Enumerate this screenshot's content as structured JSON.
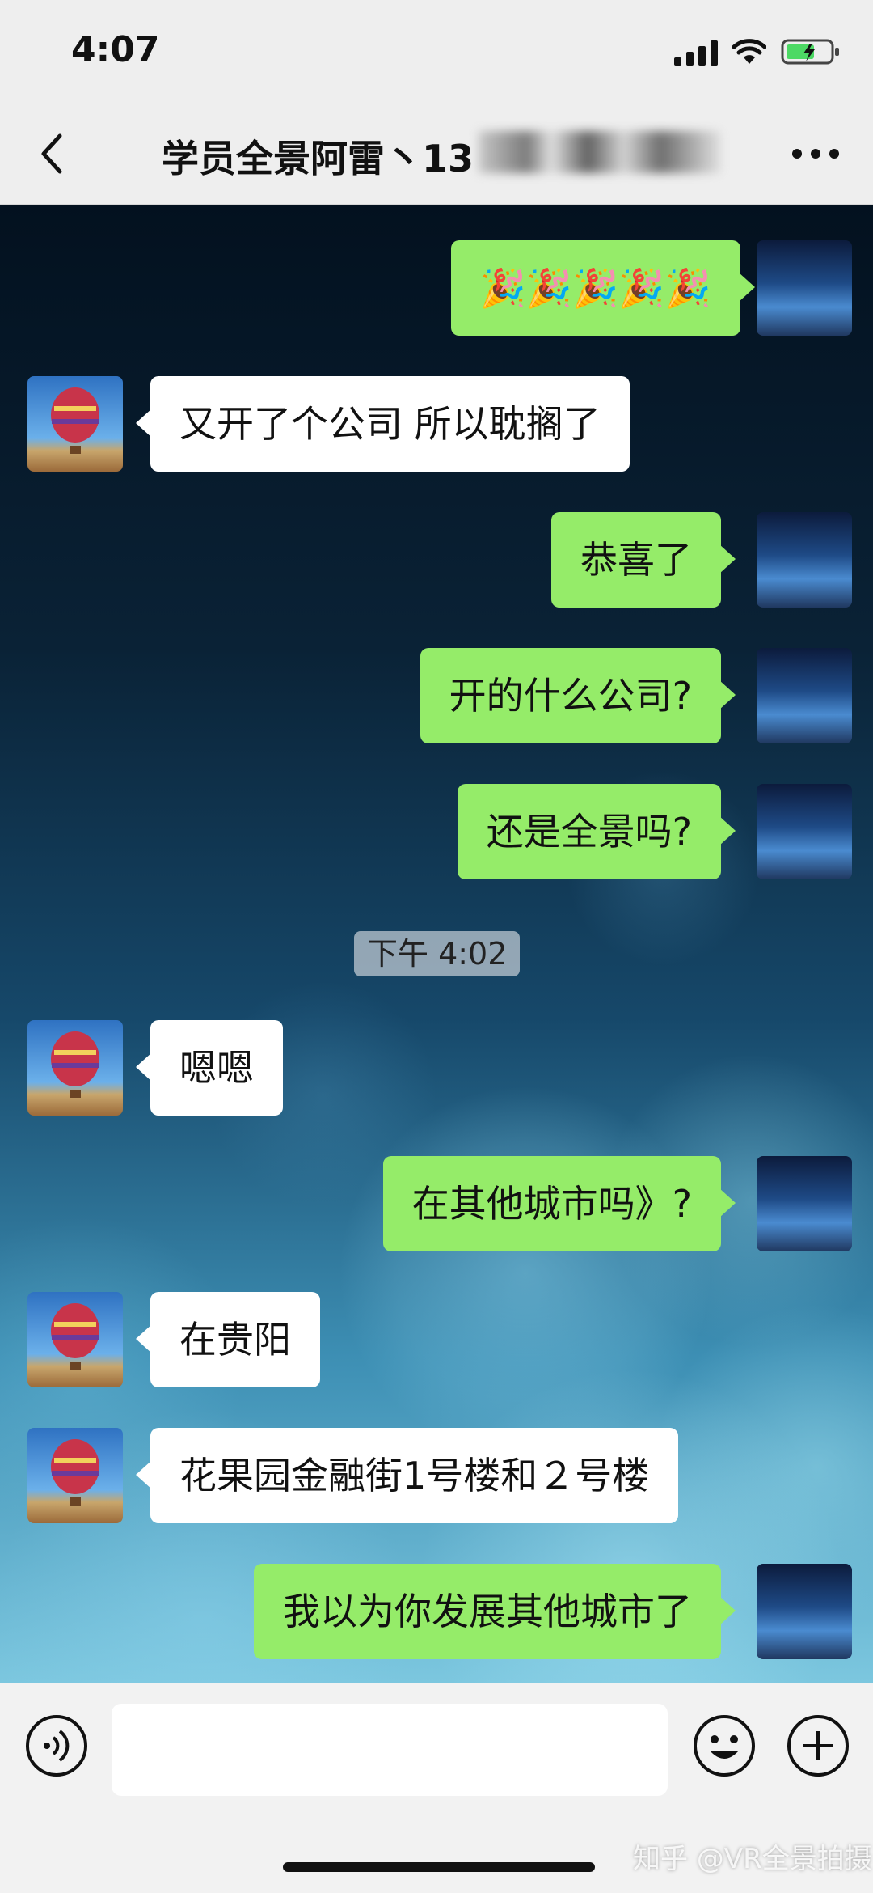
{
  "status_bar": {
    "time": "4:07"
  },
  "header": {
    "title": "学员全景阿雷丶13"
  },
  "messages": [
    {
      "side": "right",
      "text": "🎉🎉🎉🎉🎉"
    },
    {
      "side": "left",
      "text": "又开了个公司 所以耽搁了"
    },
    {
      "side": "right",
      "text": "恭喜了"
    },
    {
      "side": "right",
      "text": "开的什么公司?"
    },
    {
      "side": "right",
      "text": "还是全景吗?"
    },
    {
      "side": "left",
      "text": "嗯嗯"
    },
    {
      "side": "right",
      "text": "在其他城市吗》?"
    },
    {
      "side": "left",
      "text": "在贵阳"
    },
    {
      "side": "left",
      "text": "花果园金融街1号楼和２号楼"
    },
    {
      "side": "right",
      "text": "我以为你发展其他城市了"
    }
  ],
  "timestamp": "下午 4:02",
  "input": {
    "value": ""
  },
  "watermark": "知乎 @VR全景拍摄",
  "colors": {
    "sent_bubble": "#95ec69",
    "received_bubble": "#ffffff",
    "header_bg": "#eeeeee"
  },
  "icons": [
    "back-icon",
    "more-icon",
    "voice-icon",
    "emoji-icon",
    "plus-icon",
    "signal-icon",
    "wifi-icon",
    "battery-icon"
  ]
}
